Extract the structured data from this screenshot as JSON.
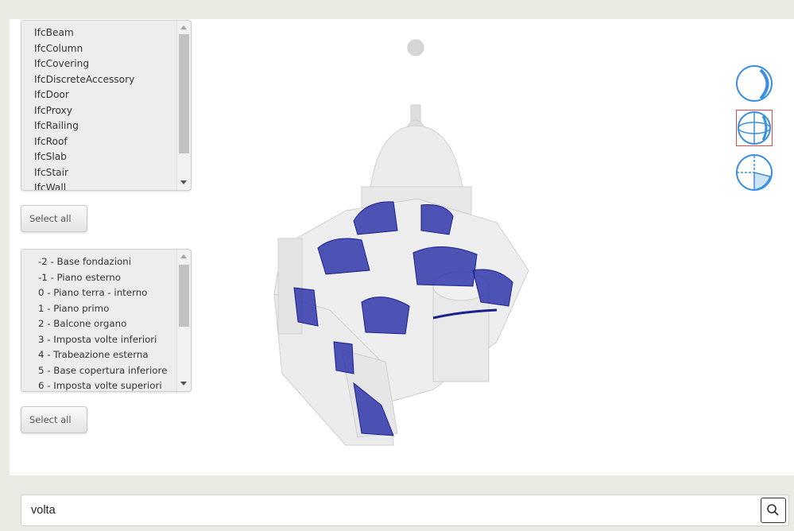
{
  "ifc_types": {
    "items": [
      "IfcBeam",
      "IfcColumn",
      "IfcCovering",
      "IfcDiscreteAccessory",
      "IfcDoor",
      "IfcProxy",
      "IfcRailing",
      "IfcRoof",
      "IfcSlab",
      "IfcStair",
      "IfcWall"
    ],
    "select_all_label": "Select all"
  },
  "storeys": {
    "items": [
      "-2 - Base fondazioni",
      "-1 - Piano esterno",
      "0 - Piano terra - interno",
      "1 - Piano primo",
      "2 - Balcone organo",
      "3 - Imposta volte inferiori",
      "4 - Trabeazione esterna",
      "5 - Base copertura inferiore",
      "6 - Imposta volte superiori"
    ],
    "select_all_label": "Select all"
  },
  "viewer": {
    "nav_icons": [
      "orbit-sphere-icon",
      "globe-grid-icon",
      "section-sphere-icon"
    ],
    "selected_nav": "globe-grid-icon",
    "highlight_color": "#2a2fa8",
    "model_color": "#dcdcdc",
    "selection_outline_color": "#e04848"
  },
  "search": {
    "value": "volta",
    "button_icon": "search-icon"
  }
}
